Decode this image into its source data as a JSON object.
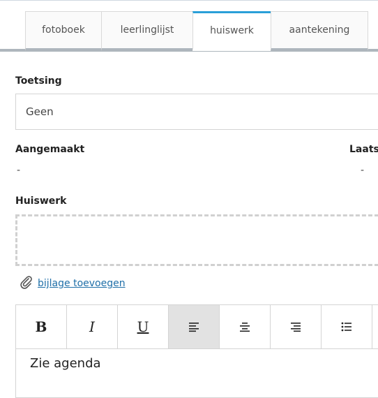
{
  "tabs": [
    {
      "label": "fotoboek",
      "active": false
    },
    {
      "label": "leerlinglijst",
      "active": false
    },
    {
      "label": "huiswerk",
      "active": true
    },
    {
      "label": "aantekening",
      "active": false
    }
  ],
  "toetsing": {
    "label": "Toetsing",
    "value": "Geen"
  },
  "aangemaakt": {
    "label": "Aangemaakt",
    "value": "-"
  },
  "laatst": {
    "label": "Laats",
    "value": "-"
  },
  "huiswerk": {
    "label": "Huiswerk"
  },
  "attachment": {
    "label": "bijlage toevoegen",
    "icon": "paperclip-icon"
  },
  "toolbar": {
    "buttons": [
      {
        "icon": "bold-icon",
        "glyph": "B"
      },
      {
        "icon": "italic-icon",
        "glyph": "I"
      },
      {
        "icon": "underline-icon",
        "glyph": "U"
      },
      {
        "icon": "align-left-icon",
        "active": true
      },
      {
        "icon": "align-center-icon"
      },
      {
        "icon": "align-right-icon"
      },
      {
        "icon": "bullet-list-icon"
      }
    ]
  },
  "editor": {
    "text": "Zie agenda"
  },
  "colors": {
    "accent": "#2a9fd8",
    "link": "#1f6fa8"
  }
}
